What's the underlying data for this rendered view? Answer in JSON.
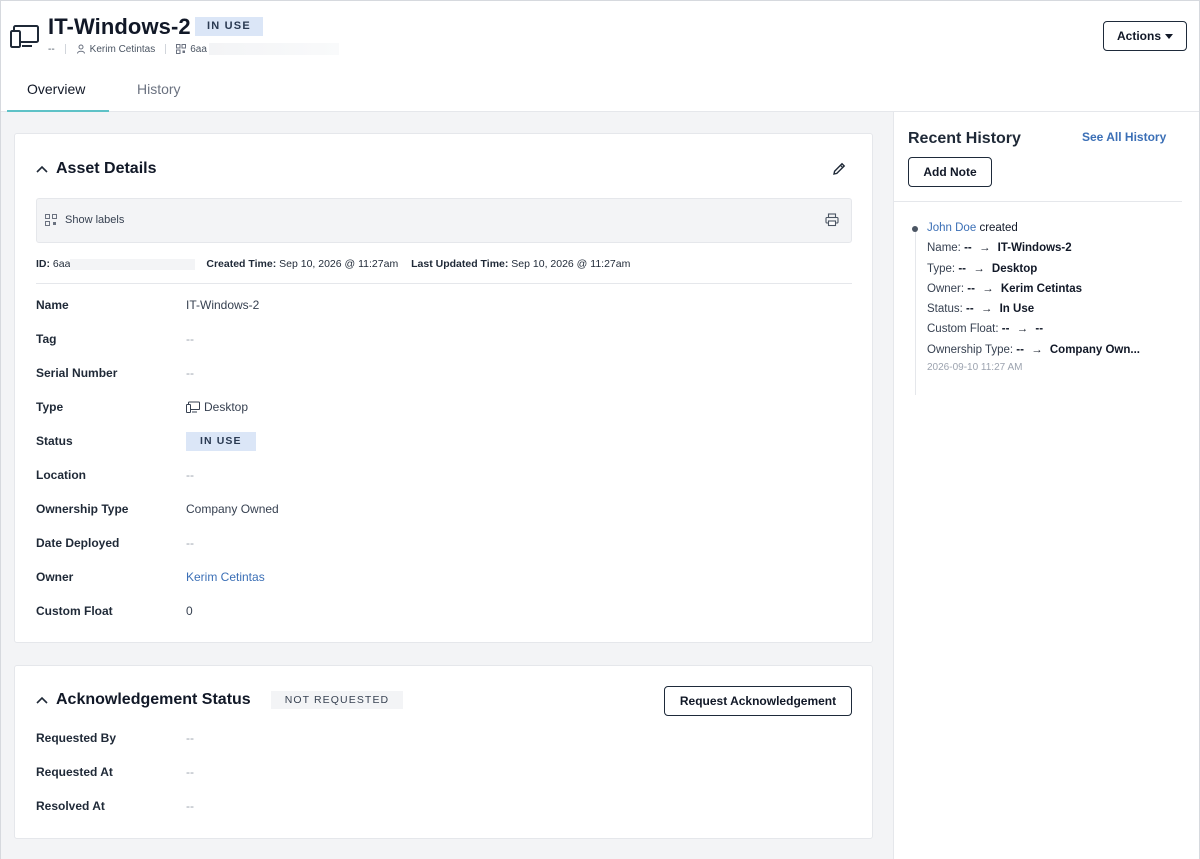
{
  "asset": {
    "title": "IT-Windows-2",
    "status_badge": "IN USE",
    "sub_dash": "--",
    "owner_short": "Kerim Cetintas",
    "id_short": "6aa"
  },
  "header": {
    "actions_label": "Actions"
  },
  "tabs": [
    {
      "label": "Overview"
    },
    {
      "label": "History"
    }
  ],
  "asset_details": {
    "title": "Asset Details",
    "show_labels": "Show labels",
    "meta": {
      "id_label": "ID:",
      "id_value": "6aa",
      "created_label": "Created Time:",
      "created_value": "Sep 10, 2026 @ 11:27am",
      "updated_label": "Last Updated Time:",
      "updated_value": "Sep 10, 2026 @ 11:27am"
    },
    "fields": {
      "name": {
        "label": "Name",
        "value": "IT-Windows-2"
      },
      "tag": {
        "label": "Tag",
        "value": "--"
      },
      "serial": {
        "label": "Serial Number",
        "value": "--"
      },
      "type": {
        "label": "Type",
        "value": "Desktop"
      },
      "status": {
        "label": "Status",
        "value": "IN USE"
      },
      "location": {
        "label": "Location",
        "value": "--"
      },
      "ownership": {
        "label": "Ownership Type",
        "value": "Company Owned"
      },
      "deployed": {
        "label": "Date Deployed",
        "value": "--"
      },
      "owner": {
        "label": "Owner",
        "value": "Kerim Cetintas"
      },
      "custom_float": {
        "label": "Custom Float",
        "value": "0"
      }
    }
  },
  "acknowledgement": {
    "title": "Acknowledgement Status",
    "badge": "NOT REQUESTED",
    "button": "Request Acknowledgement",
    "fields": {
      "requested_by": {
        "label": "Requested By",
        "value": "--"
      },
      "requested_at": {
        "label": "Requested At",
        "value": "--"
      },
      "resolved_at": {
        "label": "Resolved At",
        "value": "--"
      }
    }
  },
  "recent_history": {
    "title": "Recent History",
    "see_all": "See All History",
    "add_note": "Add Note",
    "entry": {
      "actor": "John Doe",
      "verb": "created",
      "changes": [
        {
          "key": "Name:",
          "old": "--",
          "arrow": "→",
          "new": "IT-Windows-2"
        },
        {
          "key": "Type:",
          "old": "--",
          "arrow": "→",
          "new": "Desktop"
        },
        {
          "key": "Owner:",
          "old": "--",
          "arrow": "→",
          "new": "Kerim Cetintas"
        },
        {
          "key": "Status:",
          "old": "--",
          "arrow": "→",
          "new": "In Use"
        },
        {
          "key": "Custom Float:",
          "old": "--",
          "arrow": "→",
          "new": "--"
        },
        {
          "key": "Ownership Type:",
          "old": "--",
          "arrow": "→",
          "new": "Company Own..."
        }
      ],
      "timestamp": "2026-09-10 11:27 AM"
    }
  },
  "colors": {
    "accent_tab": "#5ec2c7",
    "link": "#3b6fb6",
    "badge_bg": "#dbe6f7"
  }
}
